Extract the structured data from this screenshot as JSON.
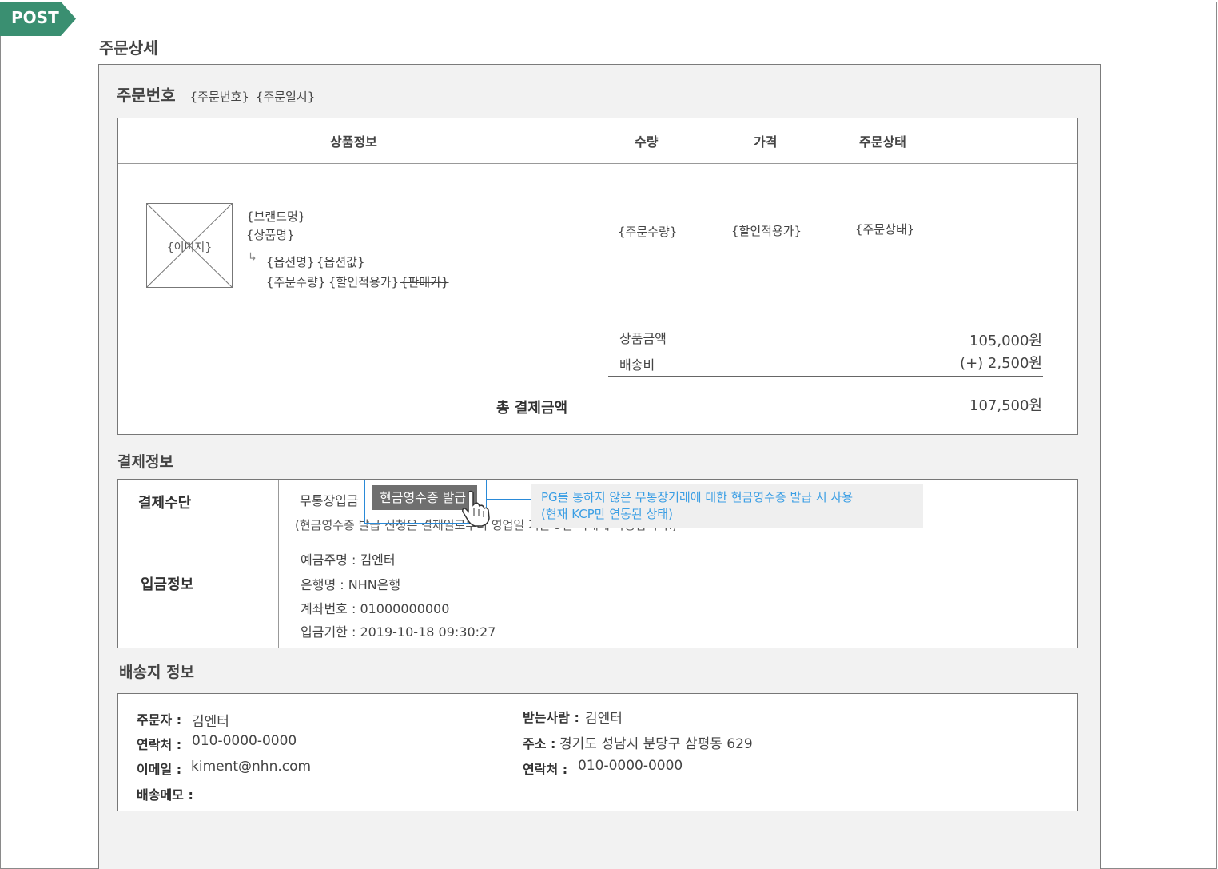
{
  "tag": "POST",
  "page_title": "주문상세",
  "order": {
    "label": "주문번호",
    "number_ph": "{주문번호}",
    "date_ph": "{주문일시}"
  },
  "product_table": {
    "headers": {
      "info": "상품정보",
      "qty": "수량",
      "price": "가격",
      "status": "주문상태"
    },
    "image_ph": "{이미지}",
    "brand": "{브랜드명}",
    "name": "{상품명}",
    "option_arrow": "↳",
    "option_name": "{옵션명}",
    "option_value": "{옵션값}",
    "sub_qty": "{주문수량}",
    "sub_discount": "{할인적용가}",
    "sub_sale": "{판매가}",
    "qty": "{주문수량}",
    "price": "{할인적용가}",
    "status": "{주문상태}"
  },
  "summary": {
    "goods_label": "상품금액",
    "goods_value": "105,000원",
    "shipping_label": "배송비",
    "shipping_value": "(+) 2,500원",
    "total_label": "총 결제금액",
    "total_value": "107,500원"
  },
  "payment": {
    "section_title": "결제정보",
    "method_label": "결제수단",
    "method_value": "무통장입금",
    "issue_button": "현금영수증 발급",
    "issue_note": "(현금영수증 발급 신청은 결제일로부터 영업일 기준 5일 이내에 가능합니다.)",
    "tooltip_line1": "PG를 통하지 않은 무통장거래에 대한 현금영수증 발급 시 사용",
    "tooltip_line2": "(현재 KCP만 연동된 상태)",
    "deposit_label": "입금정보",
    "depositor": "예금주명 : 김엔터",
    "bank": "은행명 : NHN은행",
    "account": "계좌번호 : 01000000000",
    "deadline": "입금기한 : 2019-10-18 09:30:27"
  },
  "shipping": {
    "section_title": "배송지 정보",
    "orderer_label": "주문자 :",
    "orderer_value": "김엔터",
    "contact_label": "연락처 :",
    "contact_value": "010-0000-0000",
    "email_label": "이메일 :",
    "email_value": "kiment@nhn.com",
    "memo_label": "배송메모 :",
    "receiver_label": "받는사람 :",
    "receiver_value": "김엔터",
    "address_label": "주소 :",
    "address_value": "경기도 성남시 분당구 삼평동 629",
    "receiver_contact_label": "연락처 :",
    "receiver_contact_value": "010-0000-0000"
  },
  "colors": {
    "tag": "#3a8f71",
    "tooltip_text": "#3a9ee4",
    "button": "#6f6f6f"
  }
}
